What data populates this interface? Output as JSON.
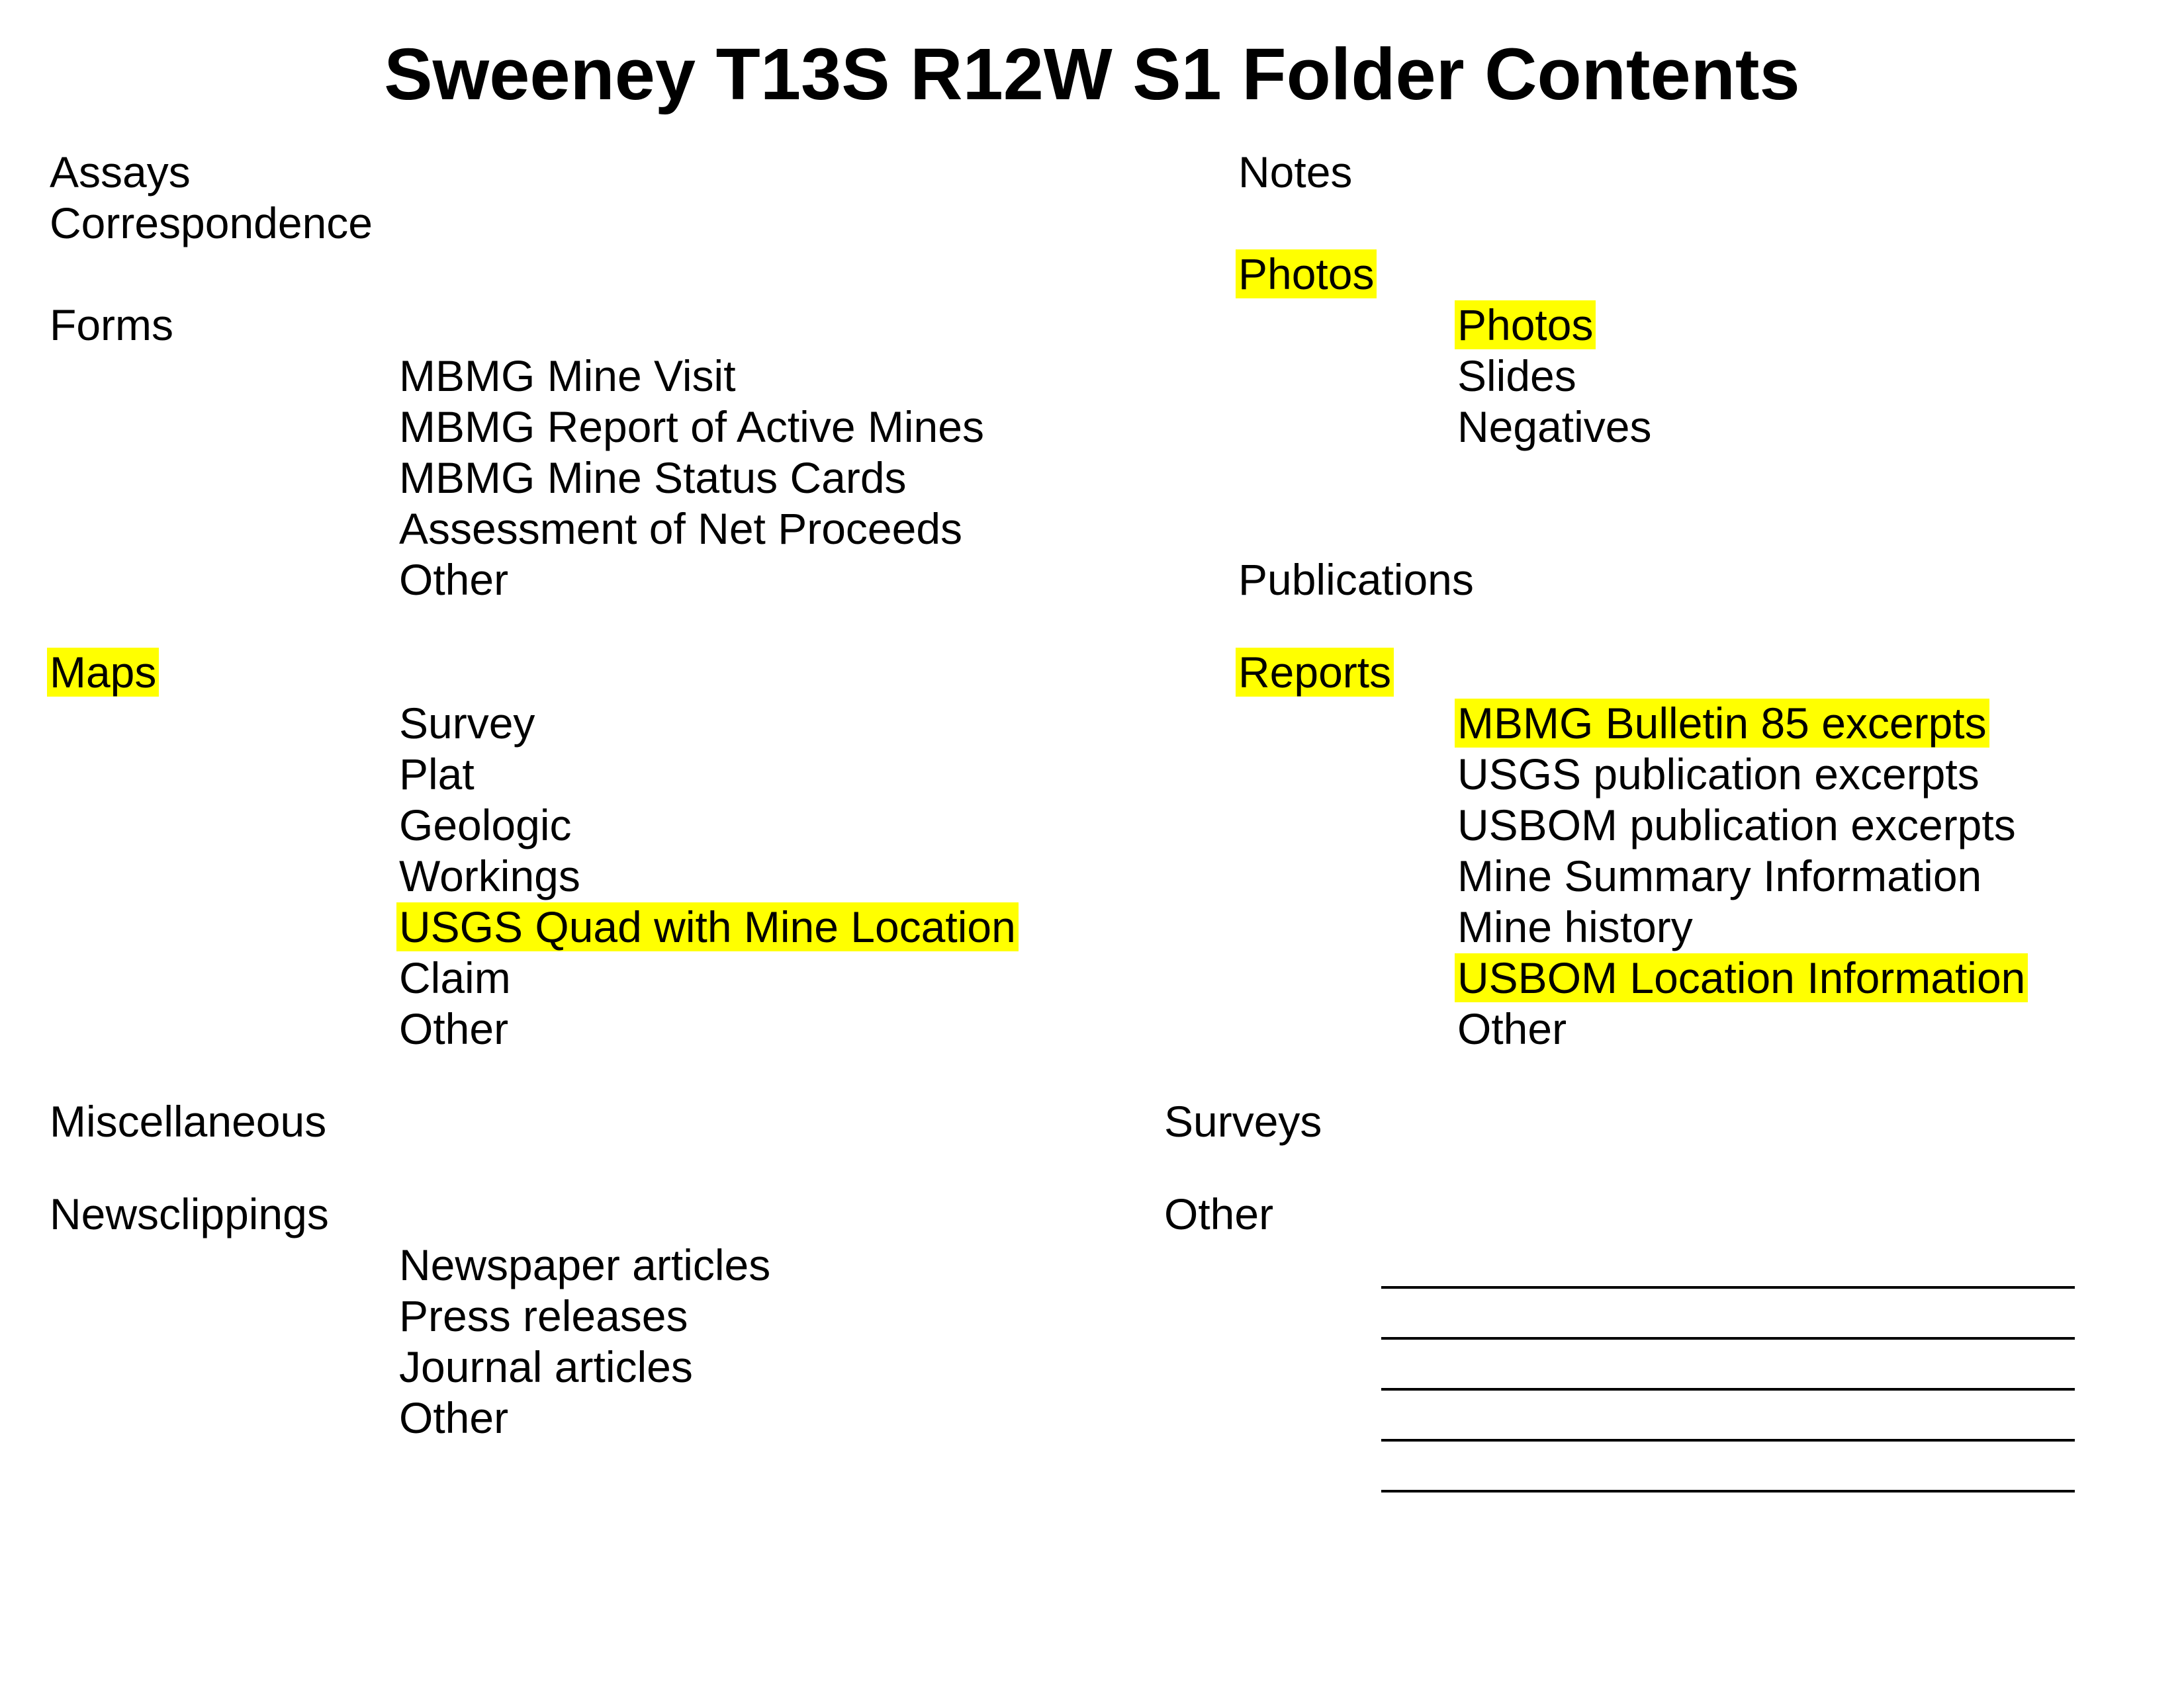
{
  "title": "Sweeney T13S R12W S1 Folder Contents",
  "highlight_color": "#ffff00",
  "left": {
    "assays": "Assays",
    "correspondence": "Correspondence",
    "forms": {
      "label": "Forms",
      "items": [
        "MBMG Mine Visit",
        "MBMG Report of Active Mines",
        "MBMG Mine Status Cards",
        "Assessment of Net Proceeds",
        "Other"
      ]
    },
    "maps": {
      "label": "Maps",
      "items": [
        "Survey",
        "Plat",
        "Geologic",
        "Workings",
        "USGS Quad with Mine Location",
        "Claim",
        "Other"
      ]
    },
    "miscellaneous": "Miscellaneous",
    "newsclippings": {
      "label": "Newsclippings",
      "items": [
        "Newspaper articles",
        "Press releases",
        "Journal articles",
        "Other"
      ]
    }
  },
  "right": {
    "notes": "Notes",
    "photos": {
      "label": "Photos",
      "items": [
        "Photos",
        "Slides",
        "Negatives"
      ]
    },
    "publications": "Publications",
    "reports": {
      "label": "Reports",
      "items": [
        "MBMG Bulletin 85 excerpts",
        "USGS publication excerpts",
        "USBOM publication excerpts",
        "Mine Summary Information",
        "Mine history",
        "USBOM Location Information",
        "Other"
      ]
    },
    "surveys": "Surveys",
    "other": "Other"
  }
}
